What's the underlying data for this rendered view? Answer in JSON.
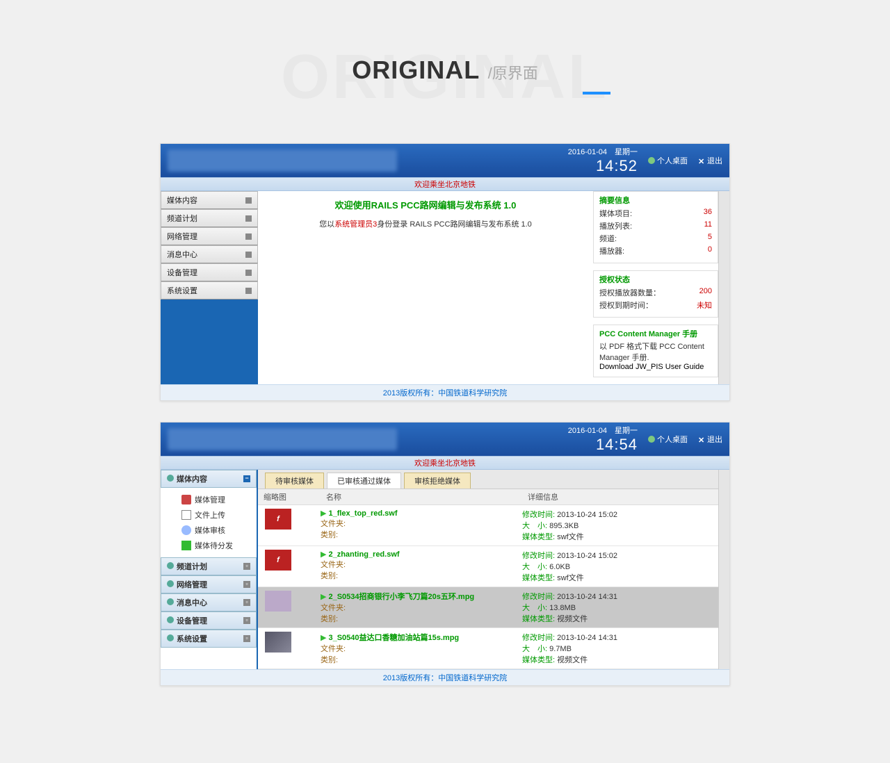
{
  "hero": {
    "ghost": "ORIGINAL",
    "title": "ORIGINAL",
    "sub": "/原界面"
  },
  "header": {
    "date": "2016-01-04",
    "weekday": "星期一",
    "personal": "个人桌面",
    "exit": "退出"
  },
  "banner": "欢迎乘坐北京地铁",
  "screen1": {
    "time": "14:52",
    "sidebar": [
      "媒体内容",
      "频道计划",
      "网络管理",
      "消息中心",
      "设备管理",
      "系统设置"
    ],
    "welcome_title": "欢迎使用RAILS PCC路网编辑与发布系统 1.0",
    "welcome_msg_pre": "您以",
    "welcome_role": "系统管理员3",
    "welcome_msg_post": "身份登录 RAILS PCC路网编辑与发布系统 1.0",
    "summary": {
      "title": "摘要信息",
      "rows": [
        {
          "k": "媒体项目:",
          "v": "36"
        },
        {
          "k": "播放列表:",
          "v": "11"
        },
        {
          "k": "频道:",
          "v": "5"
        },
        {
          "k": "播放器:",
          "v": "0"
        }
      ]
    },
    "auth": {
      "title": "授权状态",
      "rows": [
        {
          "k": "授权播放器数量：",
          "v": "200"
        },
        {
          "k": "授权到期时间：",
          "v": "未知"
        }
      ]
    },
    "manual": {
      "title": "PCC Content Manager 手册",
      "desc": "以 PDF 格式下载 PCC Content Manager 手册.",
      "link": "Download JW_PIS User Guide"
    }
  },
  "screen2": {
    "time": "14:54",
    "sidebar_active": "媒体内容",
    "sub_items": [
      "媒体管理",
      "文件上传",
      "媒体审核",
      "媒体待分发"
    ],
    "sidebar_rest": [
      "频道计划",
      "网络管理",
      "消息中心",
      "设备管理",
      "系统设置"
    ],
    "tabs": [
      "待审核媒体",
      "已审核通过媒体",
      "审核拒绝媒体"
    ],
    "active_tab": 1,
    "cols": {
      "thumb": "缩略图",
      "name": "名称",
      "info": "详细信息"
    },
    "labels": {
      "folder": "文件夹:",
      "cat": "类别:",
      "mtime": "修改时间:",
      "size": "大　小:",
      "type": "媒体类型:"
    },
    "rows": [
      {
        "idx": "1",
        "file": "flex_top_red.swf",
        "thumb": "flash",
        "mtime": "2013-10-24 15:02",
        "size": "895.3KB",
        "type": "swf文件"
      },
      {
        "idx": "2",
        "file": "zhanting_red.swf",
        "thumb": "flash",
        "mtime": "2013-10-24 15:02",
        "size": "6.0KB",
        "type": "swf文件"
      },
      {
        "idx": "2",
        "file": "S0534招商银行小李飞刀篇20s五环.mpg",
        "thumb": "video",
        "mtime": "2013-10-24 14:31",
        "size": "13.8MB",
        "type": "视频文件",
        "sel": true
      },
      {
        "idx": "3",
        "file": "S0540益达口香糖加油站篇15s.mpg",
        "thumb": "photo",
        "mtime": "2013-10-24 14:31",
        "size": "9.7MB",
        "type": "视频文件"
      }
    ]
  },
  "footer": "2013版权所有：中国铁道科学研究院"
}
